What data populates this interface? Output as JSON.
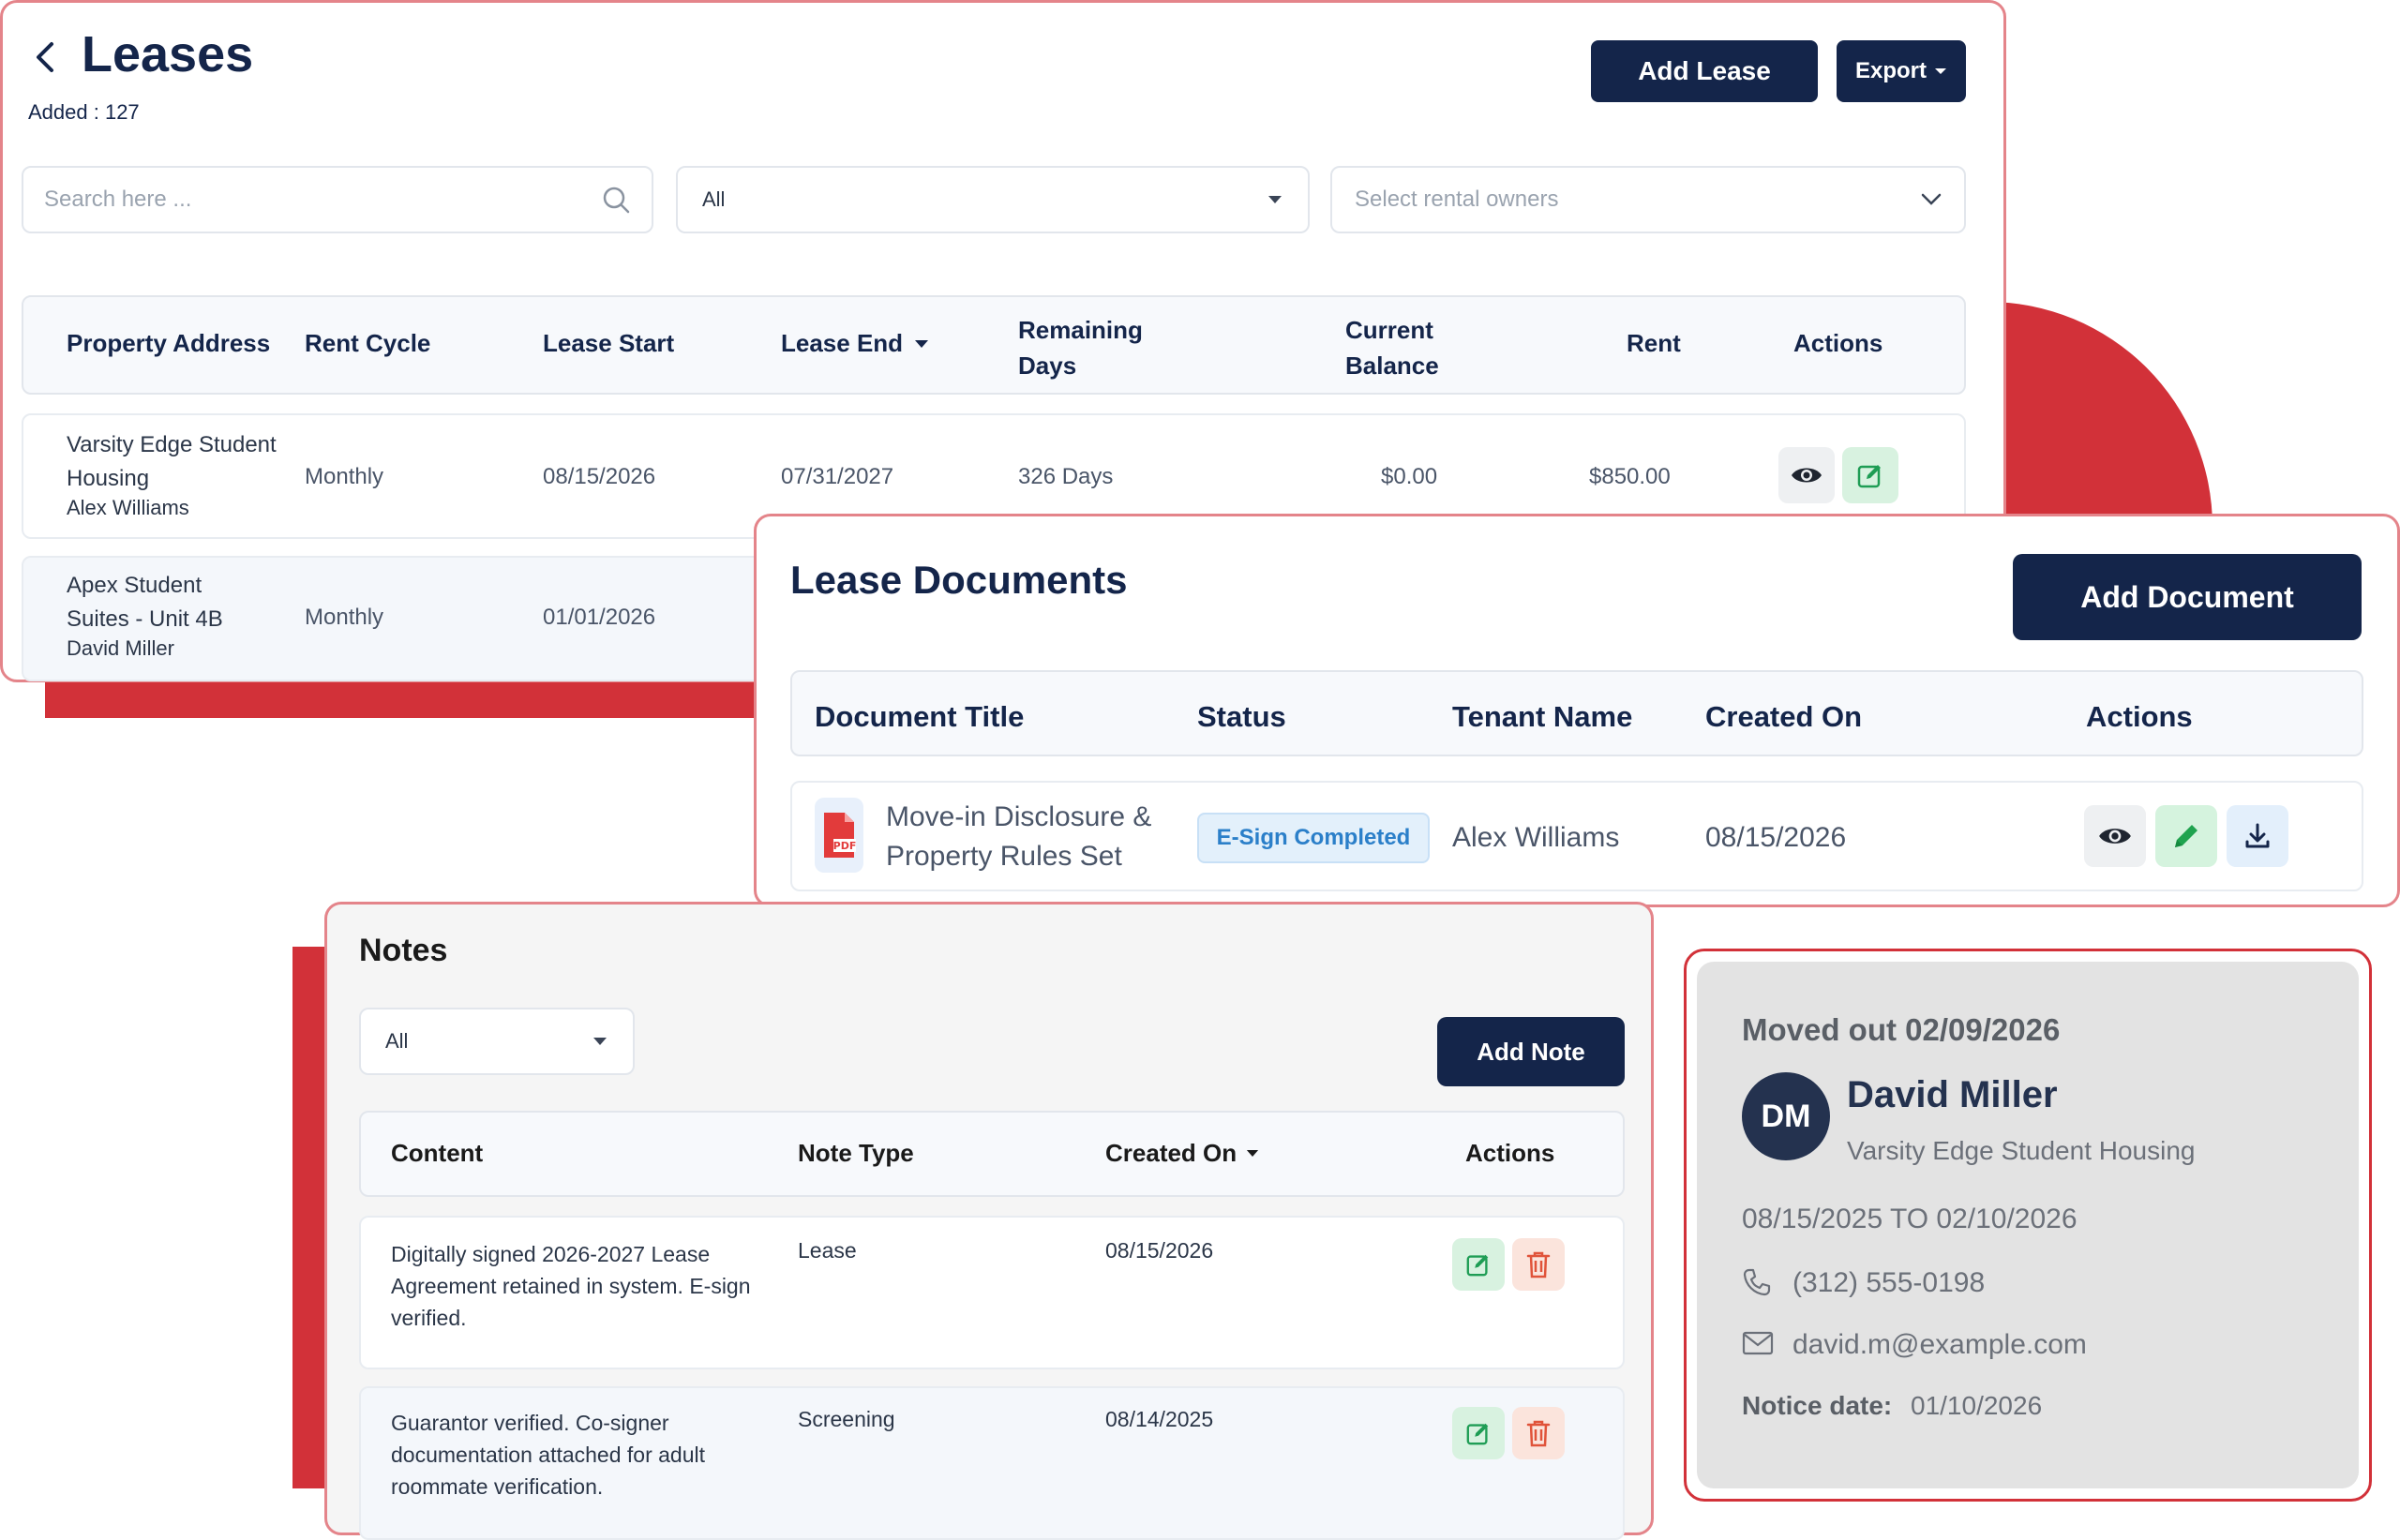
{
  "leases": {
    "title": "Leases",
    "added_label": "Added : 127",
    "add_button": "Add Lease",
    "export_button": "Export",
    "search_placeholder": "Search here ...",
    "status_filter": "All",
    "owners_placeholder": "Select rental owners",
    "columns": [
      "Property Address",
      "Rent Cycle",
      "Lease Start",
      "Lease End",
      "Remaining Days",
      "Current Balance",
      "Rent",
      "Actions"
    ],
    "rows": [
      {
        "address": "Varsity Edge Student Housing",
        "tenant": "Alex Williams",
        "cycle": "Monthly",
        "start": "08/15/2026",
        "end": "07/31/2027",
        "remaining": "326 Days",
        "balance": "$0.00",
        "rent": "$850.00"
      },
      {
        "address": "Apex Student Suites - Unit 4B",
        "tenant": "David Miller",
        "cycle": "Monthly",
        "start": "01/01/2026"
      }
    ]
  },
  "documents": {
    "title": "Lease Documents",
    "add_button": "Add Document",
    "columns": [
      "Document Title",
      "Status",
      "Tenant Name",
      "Created On",
      "Actions"
    ],
    "rows": [
      {
        "title": "Move-in Disclosure & Property Rules Set",
        "status": "E-Sign Completed",
        "tenant": "Alex Williams",
        "created": "08/15/2026",
        "file_badge": "PDF"
      }
    ]
  },
  "notes": {
    "title": "Notes",
    "filter": "All",
    "add_button": "Add Note",
    "columns": [
      "Content",
      "Note Type",
      "Created On",
      "Actions"
    ],
    "rows": [
      {
        "content": "Digitally signed 2026-2027 Lease Agreement retained in system. E-sign verified.",
        "type": "Lease",
        "created": "08/15/2026"
      },
      {
        "content": "Guarantor verified. Co-signer documentation attached for adult roommate verification.",
        "type": "Screening",
        "created": "08/14/2025"
      }
    ]
  },
  "tenant_card": {
    "moved_out": "Moved out 02/09/2026",
    "initials": "DM",
    "name": "David Miller",
    "property": "Varsity Edge Student Housing",
    "period": "08/15/2025 TO 02/10/2026",
    "phone": "(312) 555-0198",
    "email": "david.m@example.com",
    "notice_label": "Notice date:",
    "notice_value": "01/10/2026"
  },
  "colors": {
    "navy": "#14254a",
    "accent_red": "#d23139",
    "status_badge_bg": "#e3f0fb",
    "status_badge_text": "#2b7fc9",
    "edit_green": "#1f9d55",
    "delete_red": "#e0533a"
  }
}
